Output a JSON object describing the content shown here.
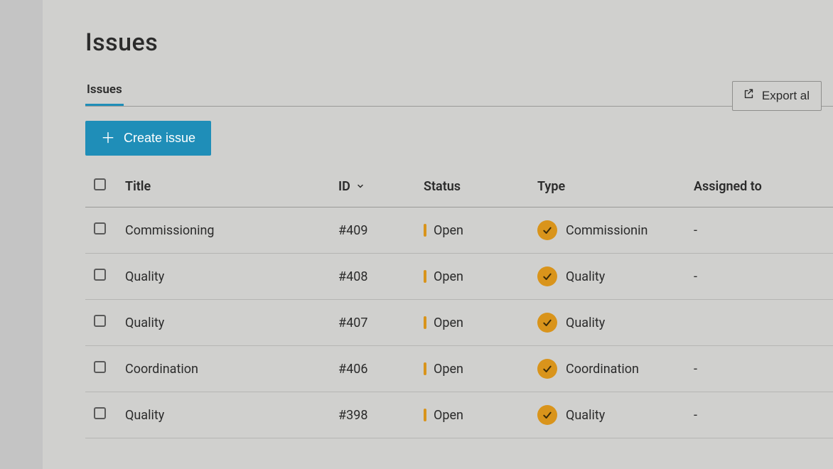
{
  "header": {
    "title": "Issues"
  },
  "tabs": {
    "active_label": "Issues"
  },
  "toolbar": {
    "create_label": "Create issue",
    "export_label": "Export al"
  },
  "table": {
    "columns": {
      "title": "Title",
      "id": "ID",
      "status": "Status",
      "type": "Type",
      "assigned_to": "Assigned to"
    },
    "rows": [
      {
        "title": "Commissioning",
        "id": "#409",
        "status": "Open",
        "type": "Commissionin",
        "assigned": "-"
      },
      {
        "title": "Quality",
        "id": "#408",
        "status": "Open",
        "type": "Quality",
        "assigned": "-"
      },
      {
        "title": "Quality",
        "id": "#407",
        "status": "Open",
        "type": "Quality",
        "assigned": ""
      },
      {
        "title": "Coordination",
        "id": "#406",
        "status": "Open",
        "type": "Coordination",
        "assigned": "-"
      },
      {
        "title": "Quality",
        "id": "#398",
        "status": "Open",
        "type": "Quality",
        "assigned": "-"
      }
    ]
  },
  "colors": {
    "accent": "#1f8eb8",
    "status_open": "#d9941b"
  }
}
